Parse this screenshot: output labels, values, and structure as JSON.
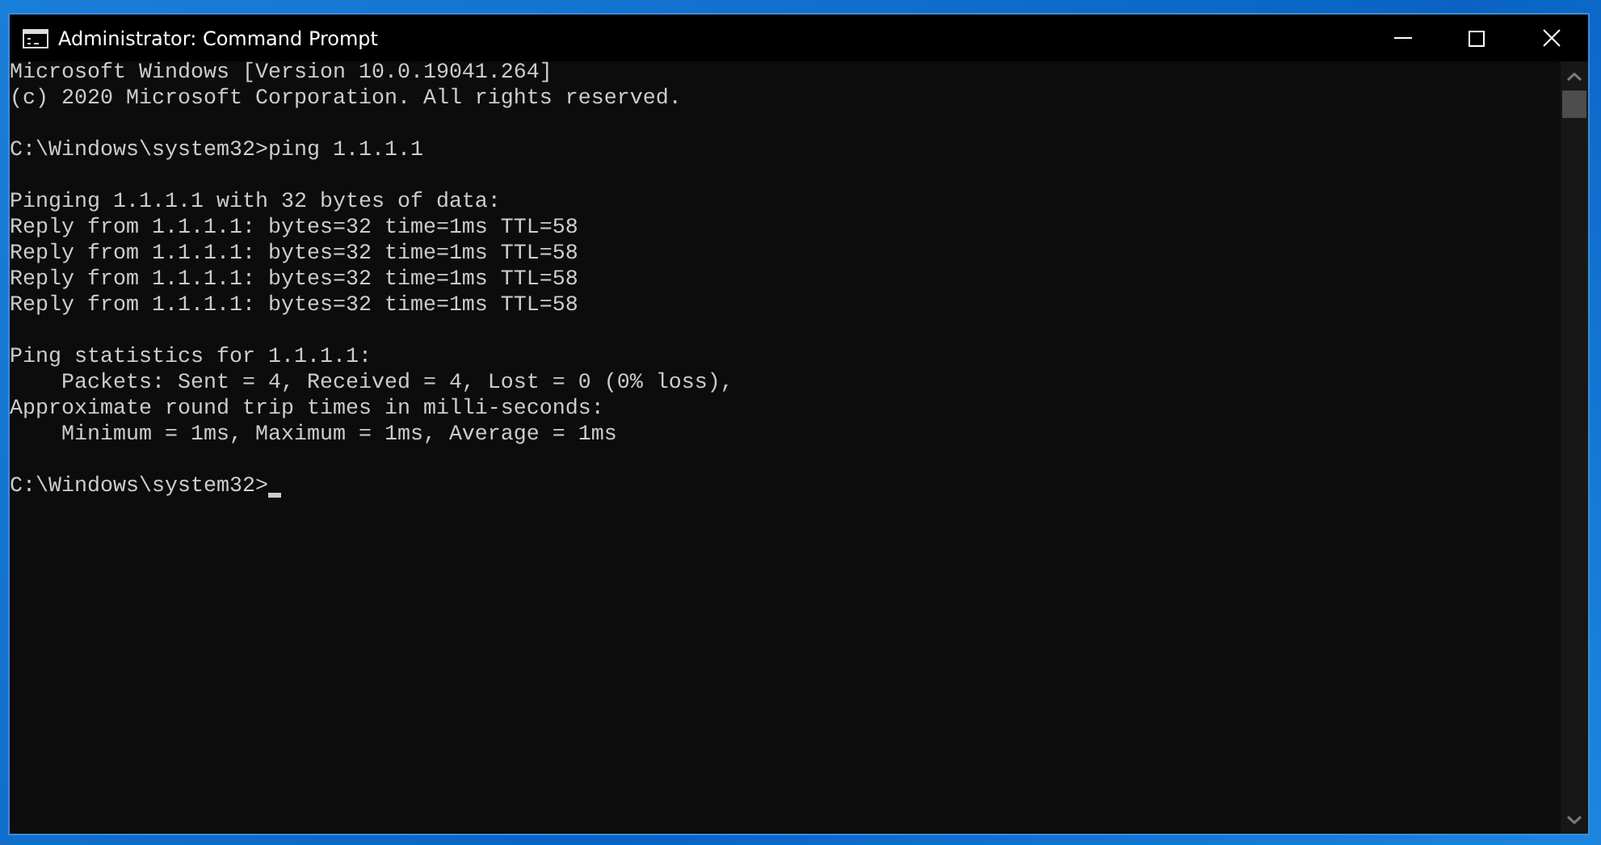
{
  "window": {
    "title": "Administrator: Command Prompt"
  },
  "console": {
    "blocks": [
      [
        "Microsoft Windows [Version 10.0.19041.264]",
        "(c) 2020 Microsoft Corporation. All rights reserved."
      ],
      [
        "C:\\Windows\\system32>ping 1.1.1.1"
      ],
      [
        "Pinging 1.1.1.1 with 32 bytes of data:",
        "Reply from 1.1.1.1: bytes=32 time=1ms TTL=58",
        "Reply from 1.1.1.1: bytes=32 time=1ms TTL=58",
        "Reply from 1.1.1.1: bytes=32 time=1ms TTL=58",
        "Reply from 1.1.1.1: bytes=32 time=1ms TTL=58"
      ],
      [
        "Ping statistics for 1.1.1.1:",
        "    Packets: Sent = 4, Received = 4, Lost = 0 (0% loss),",
        "Approximate round trip times in milli-seconds:",
        "    Minimum = 1ms, Maximum = 1ms, Average = 1ms"
      ]
    ],
    "prompt": "C:\\Windows\\system32>",
    "cursor": true
  }
}
